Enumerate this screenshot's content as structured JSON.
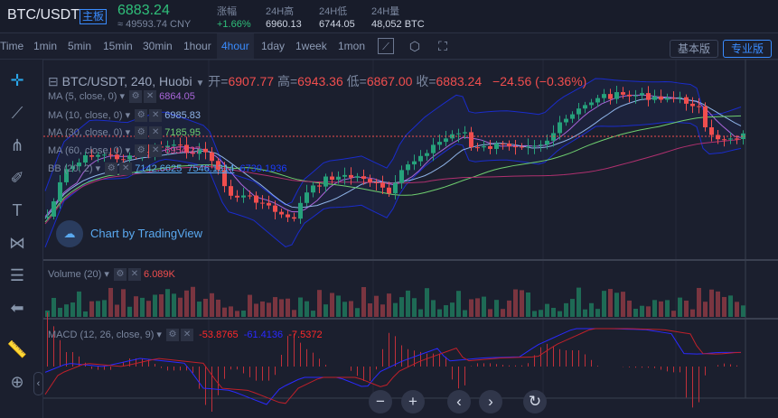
{
  "header": {
    "pair": "BTC/USDT",
    "board": "主板",
    "last_price": "6883.24",
    "cny": "≈ 49593.74 CNY",
    "stats": [
      {
        "label": "涨幅",
        "value": "+1.66%",
        "color": "#2fbf7a"
      },
      {
        "label": "24H高",
        "value": "6960.13"
      },
      {
        "label": "24H低",
        "value": "6744.05"
      },
      {
        "label": "24H量",
        "value": "48,052 BTC"
      }
    ]
  },
  "toolbar": {
    "timeframes": [
      "Time",
      "1min",
      "5min",
      "15min",
      "30min",
      "1hour",
      "4hour",
      "1day",
      "1week",
      "1mon"
    ],
    "active": "4hour",
    "icons": [
      "indicator-icon",
      "settings-hexagon-icon",
      "screenshot-icon"
    ],
    "basic_label": "基本版",
    "pro_label": "专业版"
  },
  "left_tools": [
    "crosshair-icon",
    "trend-line-icon",
    "pitchfork-icon",
    "brush-icon",
    "text-icon",
    "pattern-icon",
    "measure-lines-icon",
    "back-arrow-icon",
    "ruler-icon",
    "zoom-in-icon"
  ],
  "legend": {
    "title": "BTC/USDT, 240, Huobi",
    "ohlc": [
      {
        "k": "开=",
        "v": "6907.77"
      },
      {
        "k": "高=",
        "v": "6943.36"
      },
      {
        "k": "低=",
        "v": "6867.00"
      },
      {
        "k": "收=",
        "v": "6883.24"
      }
    ],
    "change": "−24.56 (−0.36%)",
    "studies": [
      {
        "label": "MA (5, close, 0)",
        "value": "6864.05",
        "color": "#a865d8"
      },
      {
        "label": "MA (10, close, 0)",
        "value": "6985.83",
        "color": "#8fb4e8"
      },
      {
        "label": "MA (30, close, 0)",
        "value": "7185.95",
        "color": "#6fcf6f"
      },
      {
        "label": "MA (60, close, 0)",
        "value": "6954.27",
        "color": "#e0438f"
      },
      {
        "label": "BB (20, 2)",
        "values": [
          "7142.6625",
          "7546.1314",
          "6739.1936"
        ]
      }
    ],
    "watermark": "Chart by TradingView"
  },
  "volume": {
    "label": "Volume (20)",
    "value": "6.089K"
  },
  "macd": {
    "label": "MACD (12, 26, close, 9)",
    "values": [
      "-53.8765",
      "-61.4136",
      "-7.5372"
    ]
  },
  "colors": {
    "up": "#26a17b",
    "down": "#f04e4e",
    "bb": "#1a2ccc",
    "background": "#1b1f2e",
    "accent": "#3a8cff"
  },
  "controls": [
    "zoom-out",
    "zoom-in",
    "scroll-left",
    "scroll-right",
    "reset"
  ],
  "control_glyphs": [
    "−",
    "+",
    "‹",
    "›",
    "↻"
  ]
}
